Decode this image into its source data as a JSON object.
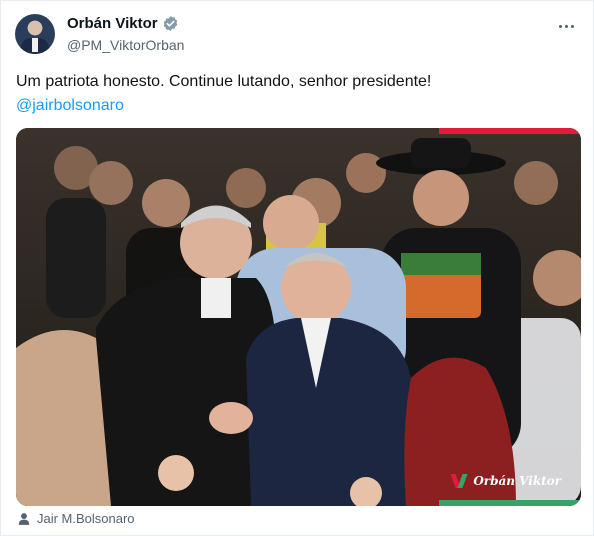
{
  "author": {
    "display_name": "Orbán Viktor",
    "handle": "@PM_ViktorOrban",
    "verified": true,
    "avatar_icon": "profile-photo"
  },
  "more_icon": "ellipsis-icon",
  "tweet": {
    "text": "Um patriota honesto. Continue lutando, senhor presidente!",
    "mention": "@jairbolsonaro"
  },
  "media": {
    "description_icon": "photo",
    "watermark": "Orbán Viktor",
    "accent_colors": {
      "red": "#e31b3b",
      "green": "#36a269"
    }
  },
  "tagged": {
    "icon": "person-icon",
    "name": "Jair M.Bolsonaro"
  },
  "colors": {
    "link": "#1d9bf0",
    "verified": "#829aab",
    "secondary_text": "#536471"
  }
}
